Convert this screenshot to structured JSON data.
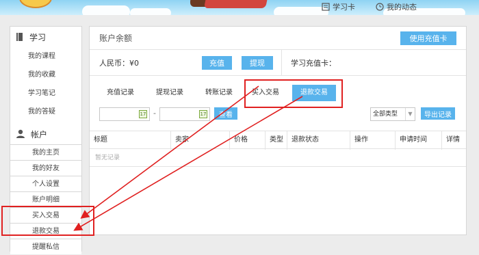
{
  "topnav": {
    "study_card": "学习卡",
    "my_activity": "我的动态"
  },
  "sidebar": {
    "study_section": "学习",
    "study_items": [
      {
        "label": "我的课程"
      },
      {
        "label": "我的收藏"
      },
      {
        "label": "学习笔记"
      },
      {
        "label": "我的答疑"
      }
    ],
    "account_section": "帐户",
    "account_items": [
      {
        "label": "我的主页"
      },
      {
        "label": "我的好友"
      },
      {
        "label": "个人设置"
      },
      {
        "label": "账户明细"
      },
      {
        "label": "买入交易"
      },
      {
        "label": "退款交易"
      },
      {
        "label": "提醒私信"
      }
    ]
  },
  "main": {
    "title": "账户余额",
    "use_card_button": "使用充值卡",
    "rmb_label": "人民币：¥0",
    "charge_button": "充值",
    "withdraw_button": "提现",
    "card_label": "学习充值卡：",
    "tabs": [
      {
        "label": "充值记录"
      },
      {
        "label": "提现记录"
      },
      {
        "label": "转账记录"
      },
      {
        "label": "买入交易"
      },
      {
        "label": "退款交易"
      }
    ],
    "active_tab": "退款交易",
    "date_separator": "-",
    "calendar_text": "17",
    "query_button": "查看",
    "type_select": "全部类型",
    "export_button": "导出记录",
    "table": {
      "columns": [
        "标题",
        "卖家",
        "价格",
        "类型",
        "退款状态",
        "操作",
        "申请时间",
        "详情"
      ],
      "empty_text": "暂无记录"
    }
  },
  "colors": {
    "accent": "#58b3ec",
    "highlight": "#e02020"
  }
}
